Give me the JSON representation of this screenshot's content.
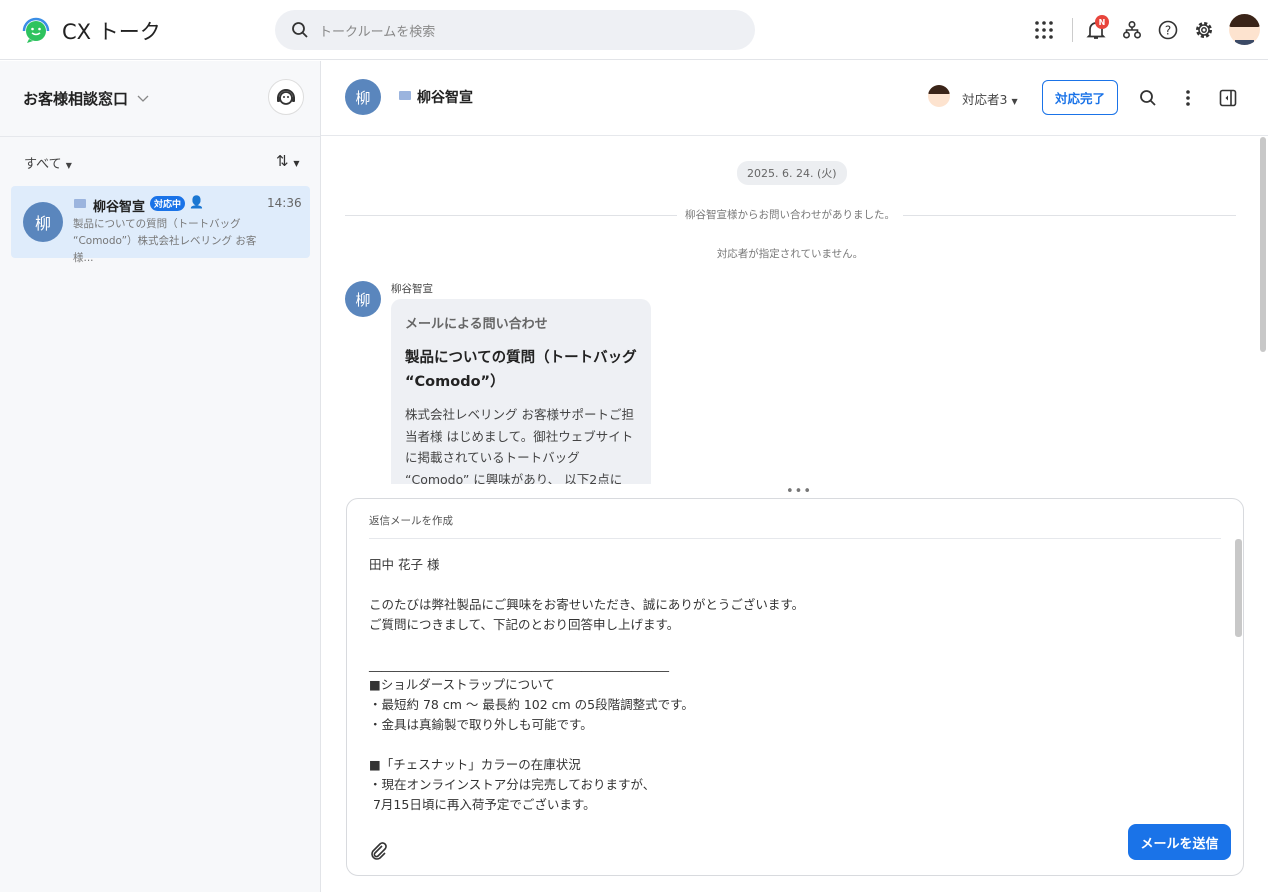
{
  "app": {
    "title": "CX トーク",
    "search_placeholder": "トークルームを検索",
    "notification_badge": "N",
    "accent": "#1a73e8"
  },
  "sidebar": {
    "title": "お客様相談窓口",
    "filter": "すべて",
    "sort_icon": "⇅",
    "items": [
      {
        "avatar": "柳",
        "name": "柳谷智宣",
        "status": "対応中",
        "time": "14:36",
        "preview": "製品についての質問（トートバッグ “Comodo”）株式会社レベリング お客様..."
      }
    ]
  },
  "conversation": {
    "avatar": "柳",
    "name": "柳谷智宣",
    "assignee": "対応者3",
    "done_button": "対応完了",
    "date": "2025. 6. 24. (火)",
    "system_inquiry": "柳谷智宣様からお問い合わせがありました。",
    "system_unassigned": "対応者が指定されていません。",
    "message": {
      "sender": "柳谷智宣",
      "avatar": "柳",
      "kind": "メールによる問い合わせ",
      "subject": "製品についての質問（トートバッグ “Comodo”）",
      "body": "株式会社レベリング お客様サポートご担当者様 はじめまして。御社ウェブサイトに掲載されているトートバッグ “Comodo” に興味があり、 以下2点に"
    }
  },
  "composer": {
    "title": "返信メールを作成",
    "send_button": "メールを送信",
    "body": "田中 花子 様\n\nこのたびは弊社製品にご興味をお寄せいただき、誠にありがとうございます。\nご質問につきまして、下記のとおり回答申し上げます。\n\n________________________________________________\n■ショルダーストラップについて\n・最短約 78 cm 〜 最長約 102 cm の5段階調整式です。\n・金具は真鍮製で取り外しも可能です。\n\n■「チェスナット」カラーの在庫状況\n・現在オンラインストア分は完売しておりますが、\n 7月15日頃に再入荷予定でございます。"
  }
}
